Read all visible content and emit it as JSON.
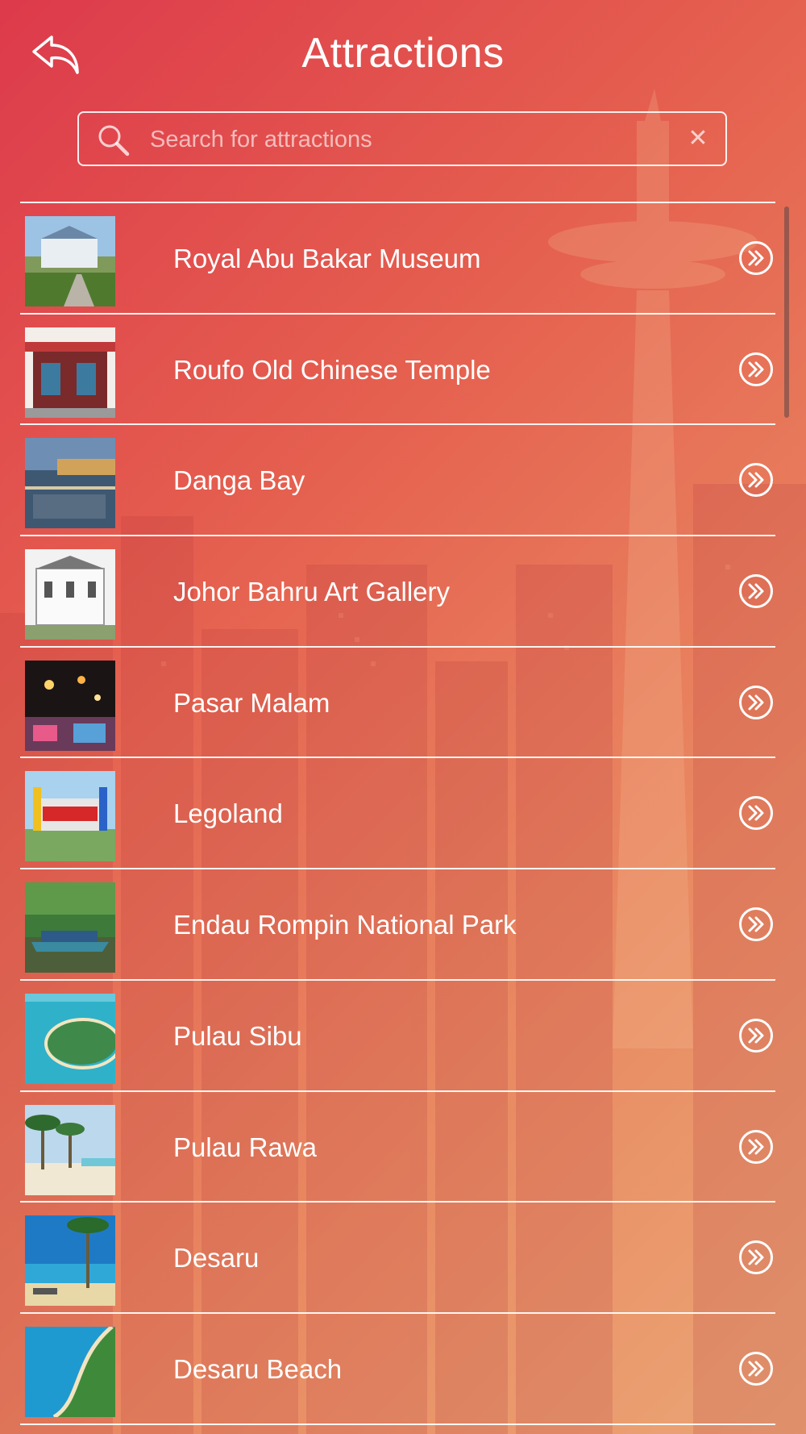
{
  "header": {
    "title": "Attractions",
    "back_icon": "back-arrow-icon"
  },
  "search": {
    "placeholder": "Search for attractions",
    "value": "",
    "clear_label": "✕"
  },
  "colors": {
    "gradient_start": "#dd3a4b",
    "gradient_end": "#eaa676",
    "text": "#ffffff"
  },
  "attractions": [
    {
      "name": "Royal Abu Bakar Museum",
      "thumb": "museum-photo"
    },
    {
      "name": "Roufo Old Chinese Temple",
      "thumb": "temple-photo"
    },
    {
      "name": "Danga Bay",
      "thumb": "waterfront-photo"
    },
    {
      "name": "Johor Bahru Art Gallery",
      "thumb": "gallery-photo"
    },
    {
      "name": "Pasar Malam",
      "thumb": "night-market-photo"
    },
    {
      "name": "Legoland",
      "thumb": "legoland-photo"
    },
    {
      "name": "Endau Rompin National Park",
      "thumb": "river-boat-photo"
    },
    {
      "name": "Pulau Sibu",
      "thumb": "island-photo"
    },
    {
      "name": "Pulau Rawa",
      "thumb": "beach-palms-photo"
    },
    {
      "name": "Desaru",
      "thumb": "desaru-beach-photo"
    },
    {
      "name": "Desaru Beach",
      "thumb": "bay-aerial-photo"
    }
  ]
}
